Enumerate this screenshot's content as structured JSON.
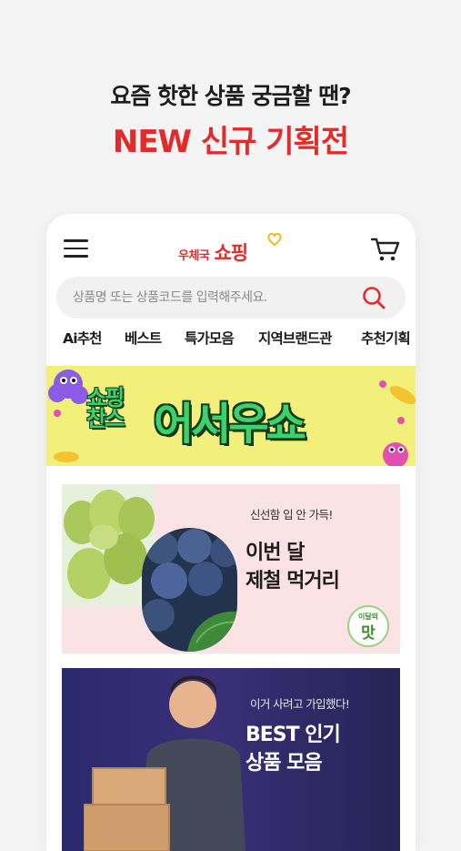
{
  "promo": {
    "line1": "요즘 핫한 상품 궁금할 땐?",
    "line2": "NEW 신규 기획전"
  },
  "app": {
    "logo_small": "우체국",
    "logo_big": "쇼핑",
    "search_placeholder": "상품명 또는 상품코드를 입력해주세요.",
    "tabs": [
      "Ai추천",
      "베스트",
      "특가모음",
      "지역브랜드관",
      "추천기획"
    ]
  },
  "banner": {
    "left_line1": "쇼핑",
    "left_line2": "찬스",
    "main_text": "어서우쇼"
  },
  "cards": [
    {
      "subtitle": "신선함 입 안 가득!",
      "title_line1": "이번 달",
      "title_line2": "제철 먹거리",
      "badge_small": "이달의",
      "badge_big": "맛"
    },
    {
      "subtitle": "이거 사려고 가입했다!",
      "title_line1": "BEST 인기",
      "title_line2": "상품 모음"
    }
  ],
  "colors": {
    "accent_red": "#e42b2b",
    "banner_yellow": "#f2f07a",
    "banner_green": "#3bd26a",
    "card1_bg": "#fbe2e4",
    "card2_bg": "#2a2a6e"
  },
  "icons": [
    "menu-icon",
    "cart-icon",
    "search-icon",
    "heart-icon"
  ]
}
